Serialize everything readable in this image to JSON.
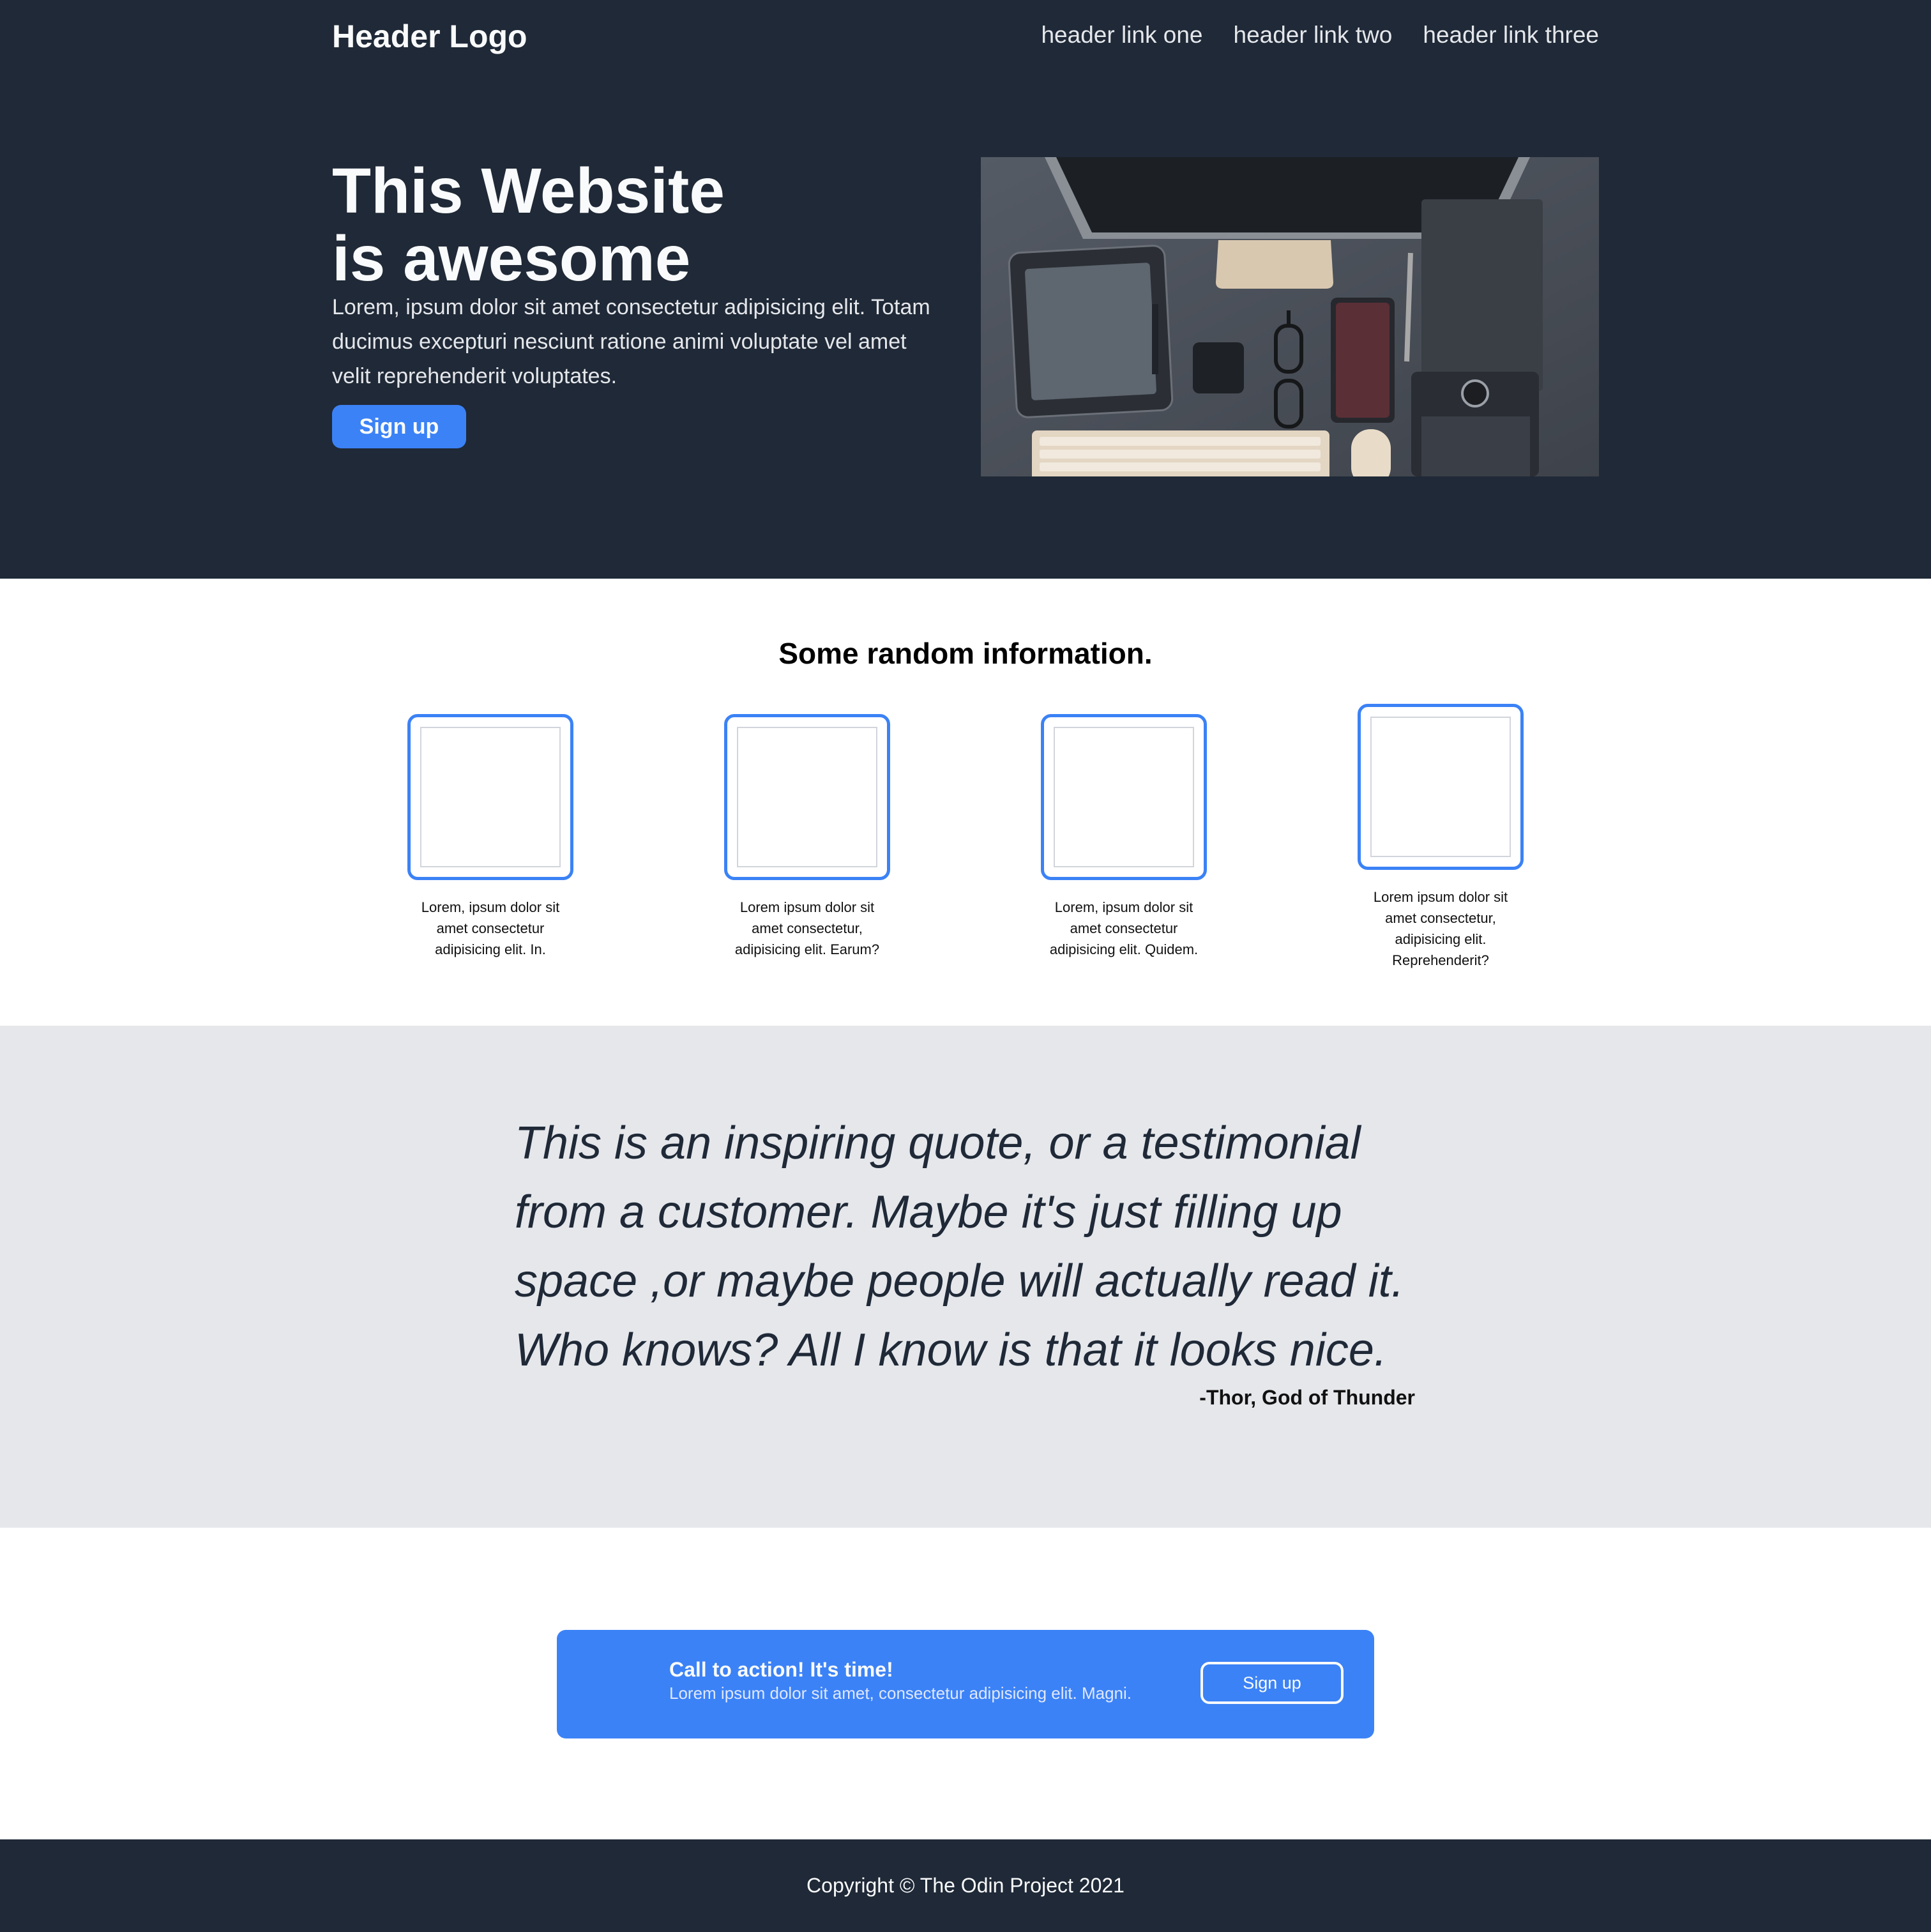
{
  "header": {
    "logo": "Header Logo",
    "links": [
      "header link one",
      "header link two",
      "header link three"
    ]
  },
  "hero": {
    "title_line1": "This Website",
    "title_line2": "is awesome",
    "text": "Lorem, ipsum dolor sit amet consectetur adipisicing elit. Totam ducimus excepturi nesciunt ratione animi voluptate vel amet velit reprehenderit voluptates.",
    "button": "Sign up",
    "image_icon": "desk-workspace-photo"
  },
  "info": {
    "title": "Some random information.",
    "cards": [
      "Lorem, ipsum dolor sit amet consectetur adipisicing elit. In.",
      "Lorem ipsum dolor sit amet consectetur, adipisicing elit. Earum?",
      "Lorem, ipsum dolor sit amet consectetur adipisicing elit. Quidem.",
      "Lorem ipsum dolor sit amet consectetur, adipisicing elit. Reprehenderit?"
    ]
  },
  "quote": {
    "text": "This is an inspiring quote, or a testimonial from a customer. Maybe it's just filling up space ,or maybe people will actually read it. Who knows? All I know is that it looks nice.",
    "author": "-Thor, God of Thunder"
  },
  "cta": {
    "title": "Call to action! It's time!",
    "text": "Lorem ipsum dolor sit amet, consectetur adipisicing elit. Magni.",
    "button": "Sign up"
  },
  "footer": {
    "text": "Copyright © The Odin Project 2021"
  },
  "colors": {
    "dark": "#1f2937",
    "accent": "#3b82f6",
    "quote_bg": "#e5e7eb"
  }
}
